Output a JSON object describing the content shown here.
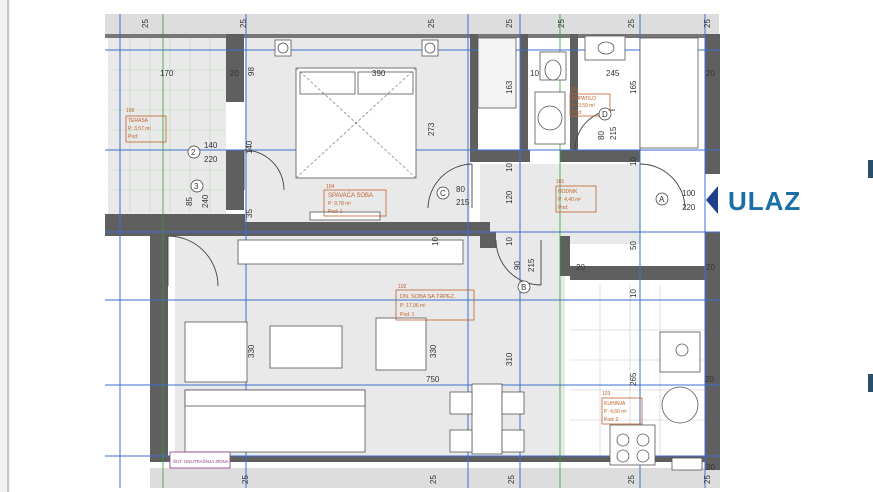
{
  "entrance": {
    "label": "ULAZ"
  },
  "dimensions": {
    "top": [
      "25",
      "25",
      "25",
      "25",
      "25",
      "25",
      "25"
    ],
    "bottom": [
      "25",
      "25",
      "25",
      "25",
      "25"
    ],
    "interior": [
      "170",
      "20",
      "98",
      "390",
      "10",
      "245",
      "20",
      "163",
      "165",
      "273",
      "140",
      "220",
      "140",
      "85",
      "240",
      "35",
      "10",
      "10",
      "120",
      "10",
      "80",
      "215",
      "80",
      "215",
      "50",
      "100",
      "220",
      "90",
      "215",
      "330",
      "330",
      "310",
      "750",
      "265",
      "20",
      "20",
      "20",
      "20",
      "10",
      "10"
    ]
  },
  "doors": [
    "2",
    "3",
    "C",
    "D",
    "A",
    "B"
  ],
  "rooms": [
    {
      "num": "106",
      "name": "TERASA",
      "area": "P: 3,57 m²",
      "floor": "Pod:"
    },
    {
      "num": "104",
      "name": "SPAVAĆA SOBA",
      "area": "P: 9,78 m²",
      "floor": "Pod: 1"
    },
    {
      "num": "105",
      "name": "KUPATILO",
      "area": "P: 3,59 m²",
      "floor": "Pod:"
    },
    {
      "num": "101",
      "name": "HODNIK",
      "area": "P: 4,40 m²",
      "floor": "Pod:"
    },
    {
      "num": "102",
      "name": "DN. SOBA SA TRPEZ.",
      "area": "P: 17,96 m²",
      "floor": "Pod: 1"
    },
    {
      "num": "103",
      "name": "KUHINJA",
      "area": "P: 4,60 m²",
      "floor": "Pod: 2"
    }
  ],
  "legend_note": "ŠUT. UNUTRAŠNJA ZIDNA"
}
